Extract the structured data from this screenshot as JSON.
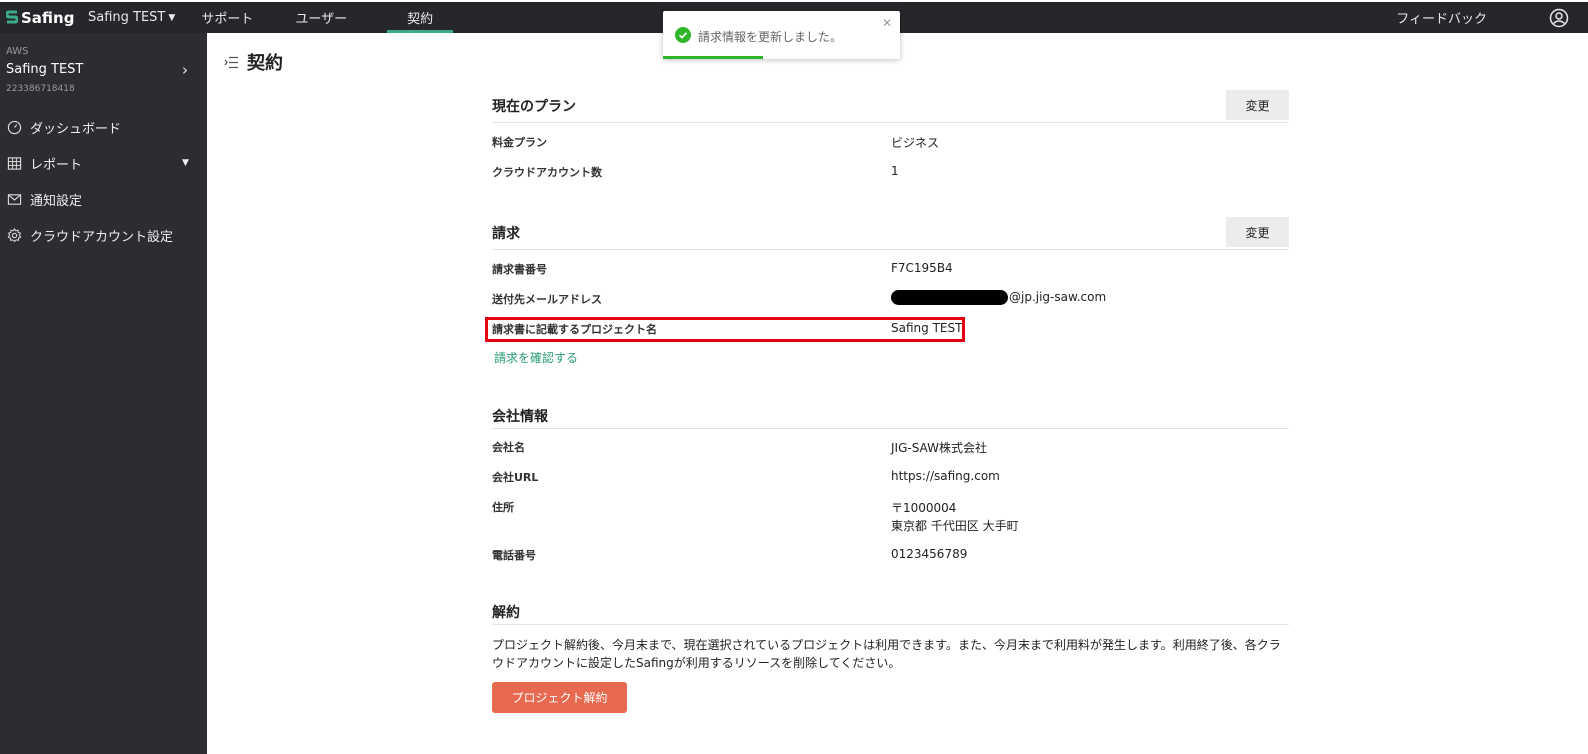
{
  "header": {
    "logo_text": "Safing",
    "project_selector": "Safing TEST",
    "nav": [
      {
        "label": "サポート"
      },
      {
        "label": "ユーザー"
      },
      {
        "label": "契約",
        "active": true
      }
    ],
    "feedback_label": "フィードバック",
    "user_icon": "user-circle-icon"
  },
  "sidebar": {
    "account": {
      "provider": "AWS",
      "name": "Safing TEST",
      "id": "223386718418"
    },
    "items": [
      {
        "label": "ダッシュボード",
        "icon": "dashboard-gauge-icon"
      },
      {
        "label": "レポート",
        "icon": "table-grid-icon",
        "expandable": true
      },
      {
        "label": "通知設定",
        "icon": "mail-icon"
      },
      {
        "label": "クラウドアカウント設定",
        "icon": "gear-icon"
      }
    ]
  },
  "page": {
    "title": "契約",
    "title_icon": "menu-collapse-icon"
  },
  "plan": {
    "title": "現在のプラン",
    "change_label": "変更",
    "rows": [
      {
        "label": "料金プラン",
        "value": "ビジネス"
      },
      {
        "label": "クラウドアカウント数",
        "value": "1"
      }
    ]
  },
  "billing": {
    "title": "請求",
    "change_label": "変更",
    "rows": [
      {
        "label": "請求書番号",
        "value": "F7C195B4"
      },
      {
        "label": "送付先メールアドレス",
        "value": "@jp.jig-saw.com"
      },
      {
        "label": "請求書に記載するプロジェクト名",
        "value": "Safing TEST"
      }
    ],
    "confirm_link": "請求を確認する"
  },
  "company": {
    "title": "会社情報",
    "rows": [
      {
        "label": "会社名",
        "value": "JIG-SAW株式会社"
      },
      {
        "label": "会社URL",
        "value": "https://safing.com"
      },
      {
        "label": "住所",
        "value_line1": "〒1000004",
        "value_line2": "東京都 千代田区 大手町"
      },
      {
        "label": "電話番号",
        "value": "0123456789"
      }
    ]
  },
  "cancellation": {
    "title": "解約",
    "description_line1": "プロジェクト解約後、今月末まで、現在選択されているプロジェクトは利用できます。また、今月末まで利用料が発生します。利用終了後、各クラ",
    "description_line2": "ウドアカウントに設定したSafingが利用するリソースを削除してください。",
    "button_label": "プロジェクト解約"
  },
  "toast": {
    "message": "請求情報を更新しました。",
    "status_color": "#2fb52a",
    "progress": 0.42
  },
  "colors": {
    "topbar": "#25272b",
    "sidebar": "#2b2d30",
    "accent": "#3caa86",
    "link": "#2a9b78",
    "danger_button": "#e7694f",
    "highlight_border": "#e60012"
  }
}
